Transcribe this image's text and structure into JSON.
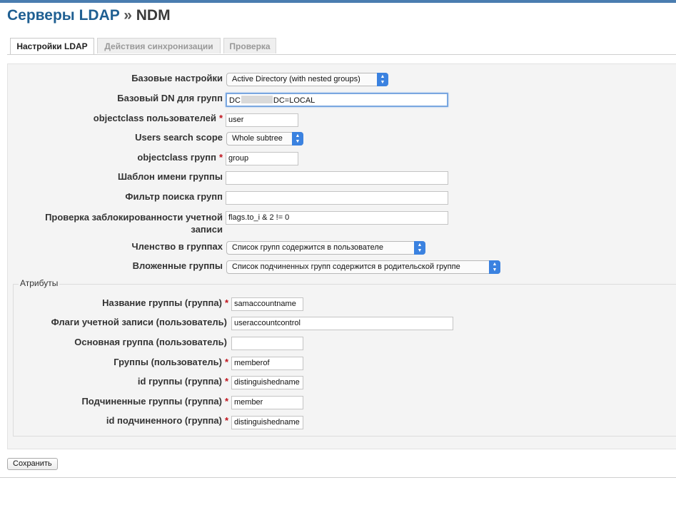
{
  "page": {
    "title": "Серверы LDAP",
    "separator": "»",
    "subtitle": "NDM"
  },
  "tabs": [
    {
      "label": "Настройки LDAP",
      "active": true
    },
    {
      "label": "Действия синхронизации",
      "active": false
    },
    {
      "label": "Проверка",
      "active": false
    }
  ],
  "form": {
    "base_settings": {
      "label": "Базовые настройки",
      "value": "Active Directory (with nested groups)"
    },
    "base_dn": {
      "label": "Базовый DN для групп",
      "value_prefix": "DC",
      "value_suffix": "DC=LOCAL"
    },
    "user_objectclass": {
      "label": "objectclass пользователей",
      "required": "*",
      "value": "user"
    },
    "users_search_scope": {
      "label": "Users search scope",
      "value": "Whole subtree"
    },
    "group_objectclass": {
      "label": "objectclass групп",
      "required": "*",
      "value": "group"
    },
    "group_name_template": {
      "label": "Шаблон имени группы",
      "value": ""
    },
    "group_search_filter": {
      "label": "Фильтр поиска групп",
      "value": ""
    },
    "account_locked_check": {
      "label": "Проверка заблокированности учетной записи",
      "value": "flags.to_i & 2 != 0"
    },
    "group_membership": {
      "label": "Членство в группах",
      "value": "Список групп содержится в пользователе"
    },
    "nested_groups": {
      "label": "Вложенные группы",
      "value": "Список подчиненных групп содержится в родительской группе"
    }
  },
  "attributes": {
    "legend": "Атрибуты",
    "group_name": {
      "label": "Название группы (группа)",
      "required": "*",
      "value": "samaccountname"
    },
    "account_flags": {
      "label": "Флаги учетной записи (пользователь)",
      "value": "useraccountcontrol"
    },
    "primary_group": {
      "label": "Основная группа (пользователь)",
      "value": ""
    },
    "user_groups": {
      "label": "Группы (пользователь)",
      "required": "*",
      "value": "memberof"
    },
    "group_id": {
      "label": "id группы (группа)",
      "required": "*",
      "value": "distinguishedname"
    },
    "child_groups": {
      "label": "Подчиненные группы (группа)",
      "required": "*",
      "value": "member"
    },
    "child_id": {
      "label": "id подчиненного (группа)",
      "required": "*",
      "value": "distinguishedname"
    }
  },
  "actions": {
    "save_label": "Сохранить"
  },
  "colors": {
    "accent": "#1f5f92",
    "required": "#c0121b",
    "select_arrow": "#3b82e0"
  },
  "icons": {
    "select_arrow": "chevron-up-down-icon"
  }
}
